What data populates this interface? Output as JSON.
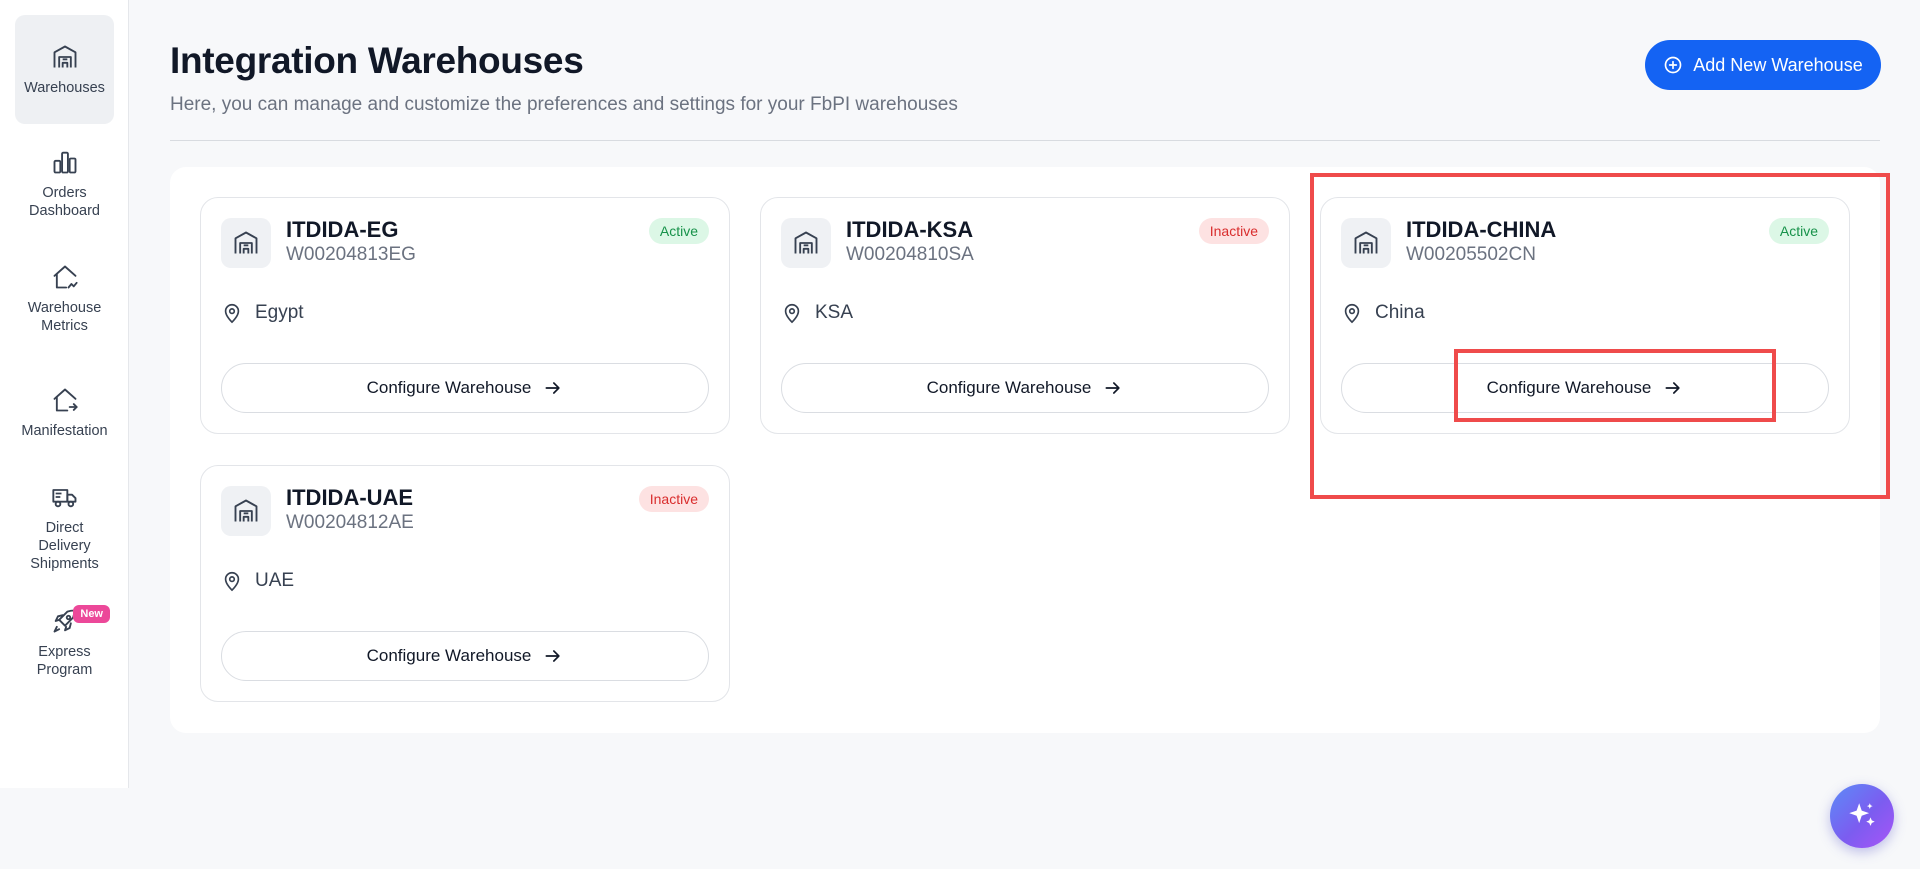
{
  "sidebar": {
    "items": [
      {
        "label": "Warehouses",
        "icon": "warehouse-icon",
        "active": true
      },
      {
        "label": "Orders Dashboard",
        "icon": "bar-chart-icon"
      },
      {
        "label": "Warehouse Metrics",
        "icon": "home-metrics-icon"
      },
      {
        "label": "Manifestation",
        "icon": "home-export-icon"
      },
      {
        "label": "Direct Delivery Shipments",
        "icon": "truck-icon"
      },
      {
        "label": "Express Program",
        "icon": "rocket-icon",
        "badge": "New"
      }
    ]
  },
  "header": {
    "title": "Integration Warehouses",
    "subtitle": "Here, you can manage and customize the preferences and settings for your FbPI warehouses",
    "add_button_label": "Add New Warehouse"
  },
  "warehouses": [
    {
      "name": "ITDIDA-EG",
      "code": "W00204813EG",
      "status": "Active",
      "location": "Egypt",
      "action": "Configure Warehouse"
    },
    {
      "name": "ITDIDA-KSA",
      "code": "W00204810SA",
      "status": "Inactive",
      "location": "KSA",
      "action": "Configure Warehouse"
    },
    {
      "name": "ITDIDA-CHINA",
      "code": "W00205502CN",
      "status": "Active",
      "location": "China",
      "action": "Configure Warehouse"
    },
    {
      "name": "ITDIDA-UAE",
      "code": "W00204812AE",
      "status": "Inactive",
      "location": "UAE",
      "action": "Configure Warehouse"
    }
  ],
  "colors": {
    "primary": "#1463f3",
    "active_text": "#17924a",
    "active_bg": "#dcf7e6",
    "inactive_text": "#d92d2d",
    "inactive_bg": "#fde2e2",
    "highlight": "#ef4b4b"
  }
}
